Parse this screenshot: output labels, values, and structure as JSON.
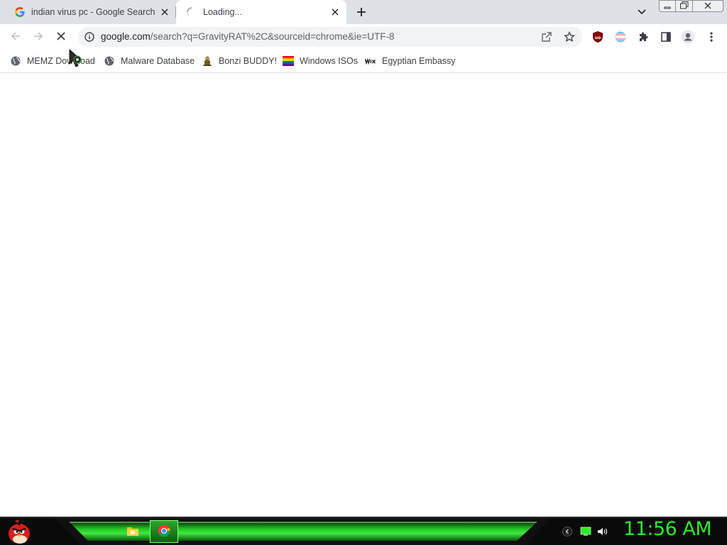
{
  "tabs": [
    {
      "title": "indian virus pc - Google Search",
      "favicon": "google-g-icon",
      "active": false
    },
    {
      "title": "Loading...",
      "favicon": "loading-spinner-icon",
      "active": true
    }
  ],
  "window_controls": [
    "minimize-icon",
    "maximize-icon",
    "close-icon"
  ],
  "address_bar": {
    "host": "google.com",
    "path": "/search?q=GravityRAT%2C&sourceid=chrome&ie=UTF-8"
  },
  "toolbar_icons": [
    "back-icon",
    "forward-icon",
    "stop-loading-icon",
    "site-info-icon",
    "share-icon",
    "star-icon",
    "ublock-icon",
    "pride-flag-icon",
    "extensions-puzzle-icon",
    "side-panel-icon",
    "profile-icon",
    "menu-dots-icon"
  ],
  "bookmarks": [
    {
      "label": "MEMZ Download",
      "icon": "globe-icon"
    },
    {
      "label": "Malware Database",
      "icon": "globe-icon"
    },
    {
      "label": "Bonzi BUDDY!",
      "icon": "bonzi-icon"
    },
    {
      "label": "Windows ISOs",
      "icon": "rainbow-flag-icon"
    },
    {
      "label": "Egyptian Embassy",
      "icon": "wix-icon"
    }
  ],
  "taskbar": {
    "start_icon": "angry-bird-icon",
    "apps": [
      "file-explorer-icon",
      "chrome-icon"
    ],
    "tray_icons": [
      "chevron-icon",
      "monitor-icon",
      "volume-icon"
    ],
    "clock": "11:56 AM"
  },
  "colors": {
    "tabstrip": "#dee1e6",
    "clock": "#2fe82f",
    "taskbar_accent": "#22c422"
  }
}
